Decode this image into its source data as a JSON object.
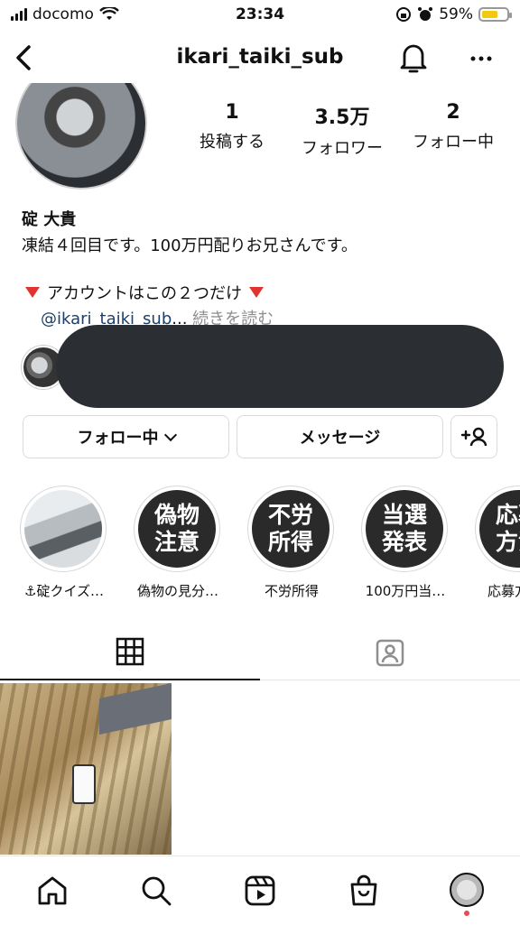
{
  "status_bar": {
    "carrier": "docomo",
    "time": "23:34",
    "battery": "59%"
  },
  "header": {
    "username": "ikari_taiki_sub"
  },
  "stats": [
    {
      "value": "1",
      "label": "投稿する"
    },
    {
      "value": "3.5万",
      "label": "フォロワー"
    },
    {
      "value": "2",
      "label": "フォロー中"
    }
  ],
  "profile": {
    "name": "碇 大貴",
    "bio_line1": "凍結４回目です。100万円配りお兄さんです。",
    "bio_line2": "アカウントはこの２つだけ",
    "bio_link": "@ikari_taiki_sub",
    "bio_ellipsis": "...",
    "bio_more": "続きを読む"
  },
  "buttons": {
    "following": "フォロー中",
    "message": "メッセージ"
  },
  "highlights": [
    {
      "title": "",
      "caption": "⚓碇クイズ…"
    },
    {
      "title": "偽物注意",
      "line1": "偽物",
      "line2": "注意",
      "caption": "偽物の見分…"
    },
    {
      "title": "不労所得",
      "line1": "不労",
      "line2": "所得",
      "caption": "不労所得"
    },
    {
      "title": "当選発表",
      "line1": "当選",
      "line2": "発表",
      "caption": "100万円当…"
    },
    {
      "title": "応募方法",
      "line1": "応募",
      "line2": "方法",
      "caption": "応募方…"
    }
  ],
  "colors": {
    "accent_link": "#1a3f6b",
    "triangle": "#e0342e",
    "notification_dot": "#ed4956",
    "battery_fill": "#f2c811"
  },
  "icons": [
    "back-chevron-icon",
    "bell-icon",
    "more-icon",
    "grid-icon",
    "tagged-icon",
    "home-icon",
    "search-icon",
    "reels-icon",
    "shop-icon"
  ]
}
